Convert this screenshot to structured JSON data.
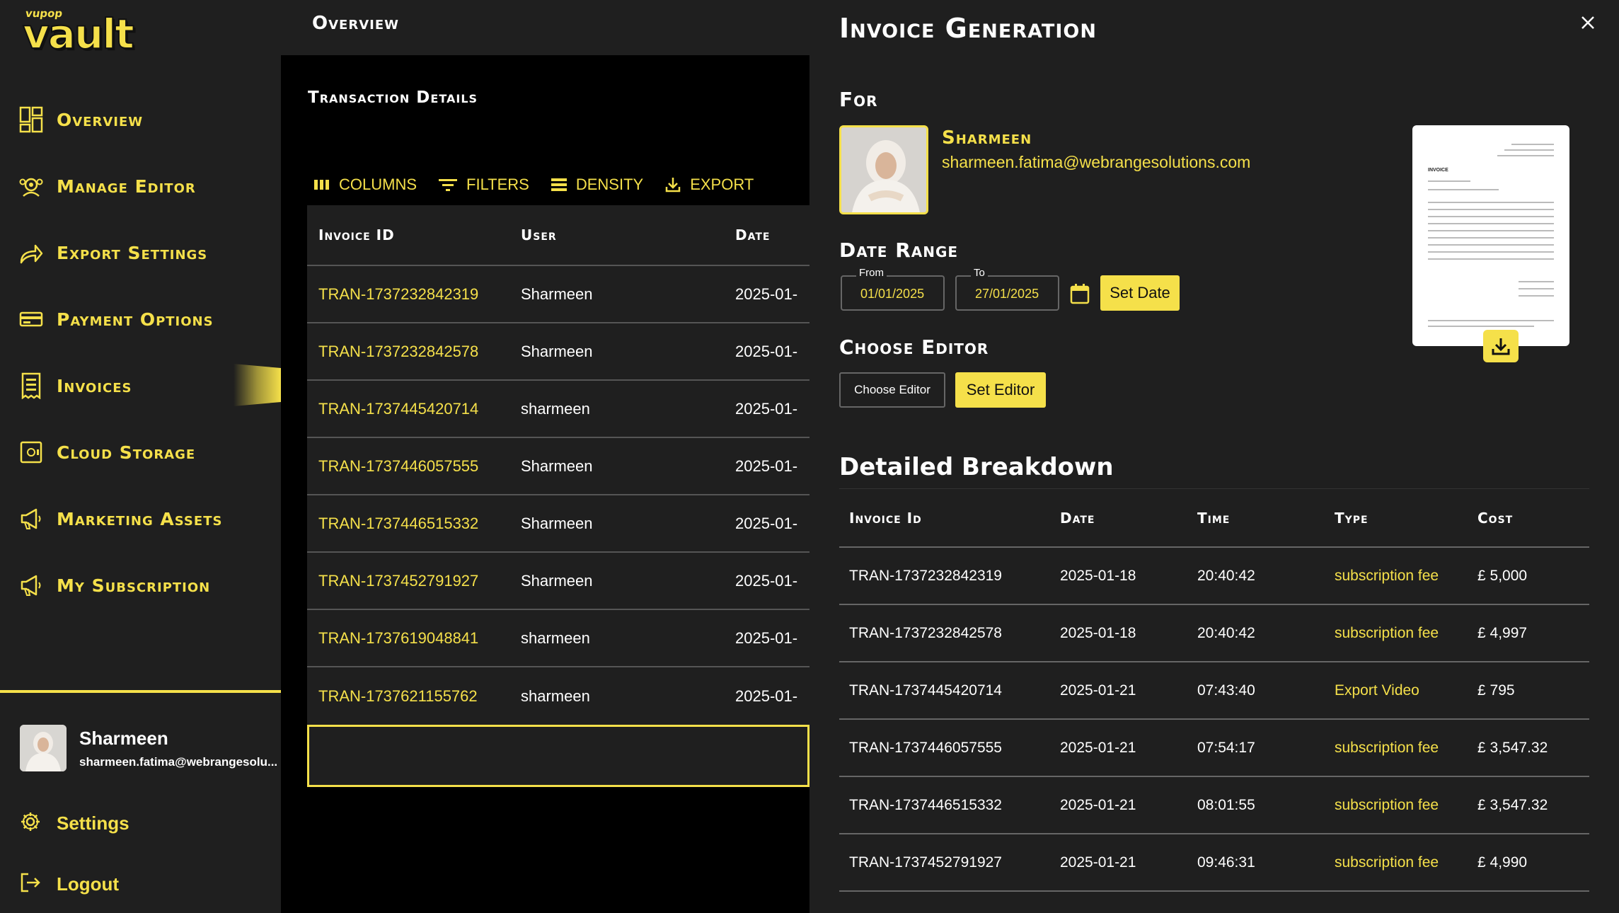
{
  "app": {
    "logo_small": "vupop",
    "logo_big": "vault"
  },
  "sidebar": {
    "items": [
      {
        "label": "Overview",
        "icon": "dashboard-icon"
      },
      {
        "label": "Manage Editor",
        "icon": "users-gear-icon"
      },
      {
        "label": "Export Settings",
        "icon": "share-arrow-icon"
      },
      {
        "label": "Payment Options",
        "icon": "credit-card-icon"
      },
      {
        "label": "Invoices",
        "icon": "receipt-icon"
      },
      {
        "label": "Cloud Storage",
        "icon": "safe-icon"
      },
      {
        "label": "Marketing Assets",
        "icon": "megaphone-icon"
      },
      {
        "label": "My Subscription",
        "icon": "megaphone-icon"
      }
    ],
    "active_index": 4,
    "profile": {
      "name": "Sharmeen",
      "email": "sharmeen.fatima@webrangesolu..."
    },
    "settings_label": "Settings",
    "logout_label": "Logout"
  },
  "main": {
    "page_title": "Overview",
    "section_title": "Transaction Details",
    "toolbar": {
      "columns": "COLUMNS",
      "filters": "FILTERS",
      "density": "DENSITY",
      "export": "EXPORT"
    },
    "table": {
      "headers": [
        "Invoice ID",
        "User",
        "Date"
      ],
      "rows": [
        [
          "TRAN-1737232842319",
          "Sharmeen",
          "2025-01-"
        ],
        [
          "TRAN-1737232842578",
          "Sharmeen",
          "2025-01-"
        ],
        [
          "TRAN-1737445420714",
          "sharmeen",
          "2025-01-"
        ],
        [
          "TRAN-1737446057555",
          "Sharmeen",
          "2025-01-"
        ],
        [
          "TRAN-1737446515332",
          "Sharmeen",
          "2025-01-"
        ],
        [
          "TRAN-1737452791927",
          "Sharmeen",
          "2025-01-"
        ],
        [
          "TRAN-1737619048841",
          "sharmeen",
          "2025-01-"
        ],
        [
          "TRAN-1737621155762",
          "sharmeen",
          "2025-01-"
        ]
      ]
    }
  },
  "panel": {
    "title": "Invoice Generation",
    "for_label": "For",
    "customer": {
      "name": "Sharmeen",
      "email": "sharmeen.fatima@webrangesolutions.com"
    },
    "date_range_label": "Date Range",
    "from_label": "From",
    "from_value": "01/01/2025",
    "to_label": "To",
    "to_value": "27/01/2025",
    "set_date_label": "Set Date",
    "choose_editor_label": "Choose Editor",
    "choose_editor_field": "Choose Editor",
    "set_editor_label": "Set Editor",
    "breakdown_title": "Detailed Breakdown",
    "breakdown": {
      "headers": [
        "Invoice Id",
        "Date",
        "Time",
        "Type",
        "Cost"
      ],
      "rows": [
        [
          "TRAN-1737232842319",
          "2025-01-18",
          "20:40:42",
          "subscription fee",
          "£  5,000"
        ],
        [
          "TRAN-1737232842578",
          "2025-01-18",
          "20:40:42",
          "subscription fee",
          "£  4,997"
        ],
        [
          "TRAN-1737445420714",
          "2025-01-21",
          "07:43:40",
          "Export Video",
          "£  795"
        ],
        [
          "TRAN-1737446057555",
          "2025-01-21",
          "07:54:17",
          "subscription fee",
          "£  3,547.32"
        ],
        [
          "TRAN-1737446515332",
          "2025-01-21",
          "08:01:55",
          "subscription fee",
          "£  3,547.32"
        ],
        [
          "TRAN-1737452791927",
          "2025-01-21",
          "09:46:31",
          "subscription fee",
          "£  4,990"
        ]
      ]
    },
    "thumbnail": {
      "heading": "INVOICE"
    }
  },
  "colors": {
    "accent": "#f5e04a",
    "sidebar_bg": "#1f1f1f",
    "page_bg": "#000000"
  }
}
